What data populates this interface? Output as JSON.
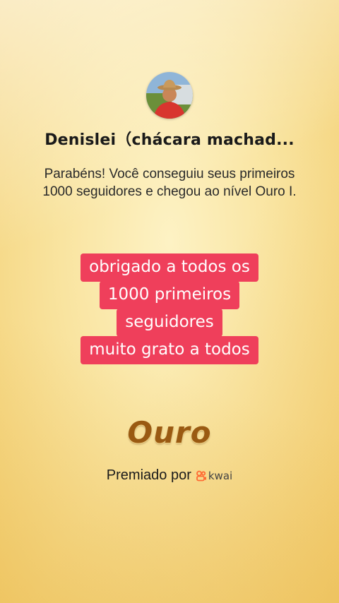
{
  "profile": {
    "username": "Denislei（chácara machad...",
    "avatar_icon": "person-with-hat-avatar"
  },
  "message": "Parabéns! Você conseguiu seus primeiros 1000 seguidores e chegou ao nível Ouro I.",
  "caption": {
    "lines": [
      "obrigado a todos os",
      "1000 primeiros",
      "seguidores",
      "muito grato a todos"
    ],
    "background_color": "#ef3f5b"
  },
  "level": {
    "name": "Ouro",
    "color": "#9a5a12"
  },
  "awarded": {
    "label": "Premiado por",
    "brand": "kwai",
    "brand_icon": "kwai-logo-icon",
    "brand_color": "#ff6a33"
  }
}
